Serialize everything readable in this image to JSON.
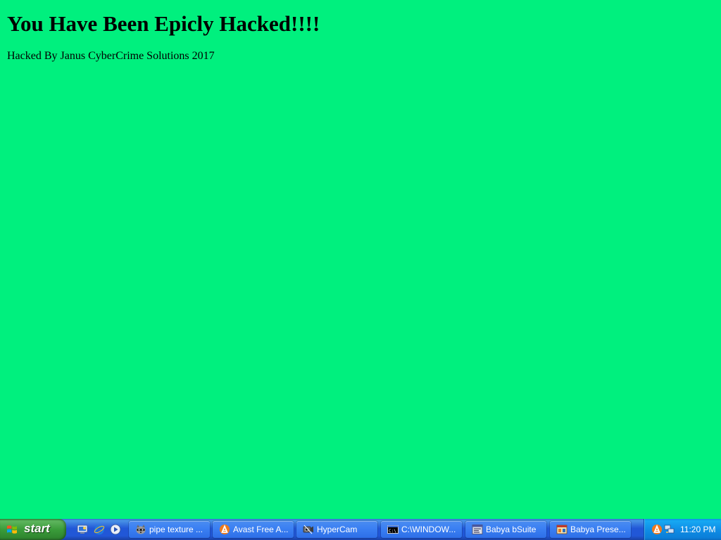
{
  "page": {
    "title": "You Have Been Epicly Hacked!!!!",
    "subtitle": "Hacked By Janus CyberCrime Solutions 2017",
    "background_color": "#00f07e"
  },
  "taskbar": {
    "start_label": "start",
    "quick_launch": [
      {
        "icon": "show-desktop-icon"
      },
      {
        "icon": "internet-explorer-icon"
      },
      {
        "icon": "media-player-icon"
      }
    ],
    "tasks": [
      {
        "label": "pipe texture ...",
        "icon": "raccoon-app-icon"
      },
      {
        "label": "Avast Free A...",
        "icon": "avast-icon"
      },
      {
        "label": "HyperCam",
        "icon": "hypercam-icon"
      },
      {
        "label": "C:\\WINDOW...",
        "icon": "command-prompt-icon"
      },
      {
        "label": "Babya bSuite",
        "icon": "babya-bsuite-icon"
      },
      {
        "label": "Babya Prese...",
        "icon": "babya-presentation-icon"
      }
    ],
    "tray": {
      "icons": [
        "avast-tray-icon",
        "network-tray-icon"
      ],
      "clock": "11:20 PM"
    }
  }
}
